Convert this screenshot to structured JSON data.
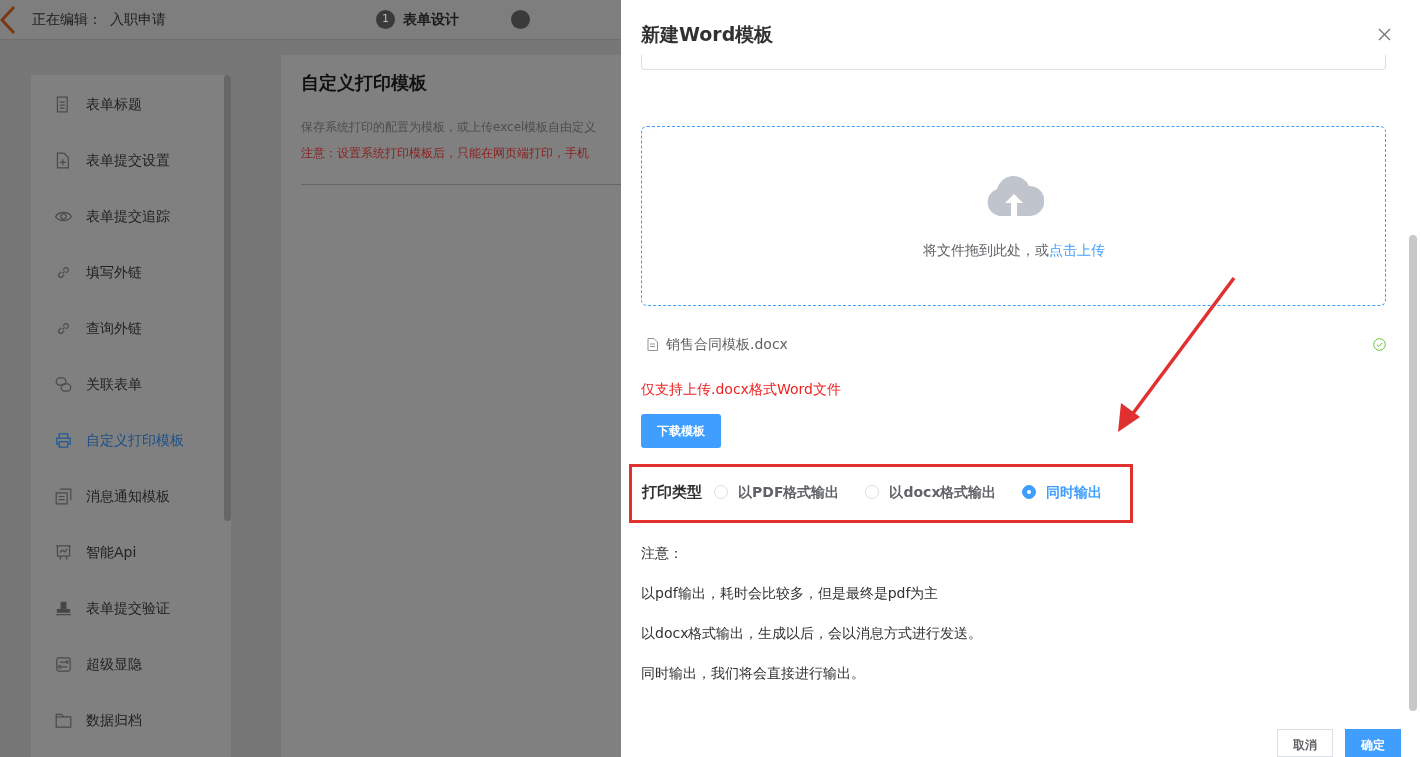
{
  "topbar": {
    "editing_label": "正在编辑：",
    "form_name": "入职申请",
    "steps": [
      {
        "number": "1",
        "label": "表单设计"
      }
    ]
  },
  "sidebar": {
    "items": [
      {
        "label": "表单标题",
        "selected": false
      },
      {
        "label": "表单提交设置",
        "selected": false
      },
      {
        "label": "表单提交追踪",
        "selected": false
      },
      {
        "label": "填写外链",
        "selected": false
      },
      {
        "label": "查询外链",
        "selected": false
      },
      {
        "label": "关联表单",
        "selected": false
      },
      {
        "label": "自定义打印模板",
        "selected": true
      },
      {
        "label": "消息通知模板",
        "selected": false
      },
      {
        "label": "智能Api",
        "selected": false
      },
      {
        "label": "表单提交验证",
        "selected": false
      },
      {
        "label": "超级显隐",
        "selected": false
      },
      {
        "label": "数据归档",
        "selected": false
      }
    ]
  },
  "main": {
    "title": "自定义打印模板",
    "description": "保存系统打印的配置为模板，或上传excel模板自由定义",
    "warning": "注意：设置系统打印模板后，只能在网页端打印，手机"
  },
  "dialog": {
    "title": "新建Word模板",
    "upload": {
      "prompt": "将文件拖到此处，或",
      "link": "点击上传"
    },
    "file": {
      "name": "销售合同模板.docx"
    },
    "hint": "仅支持上传.docx格式Word文件",
    "download_button": "下载模板",
    "print_type": {
      "label": "打印类型",
      "options": [
        {
          "label": "以PDF格式输出",
          "selected": false
        },
        {
          "label": "以docx格式输出",
          "selected": false
        },
        {
          "label": "同时输出",
          "selected": true
        }
      ]
    },
    "notes": [
      "注意：",
      "以pdf输出，耗时会比较多，但是最终是pdf为主",
      "以docx格式输出，生成以后，会以消息方式进行发送。",
      "同时输出，我们将会直接进行输出。"
    ],
    "buttons": [
      {
        "label": "取消",
        "kind": "secondary"
      },
      {
        "label": "确定",
        "kind": "primary"
      }
    ]
  }
}
